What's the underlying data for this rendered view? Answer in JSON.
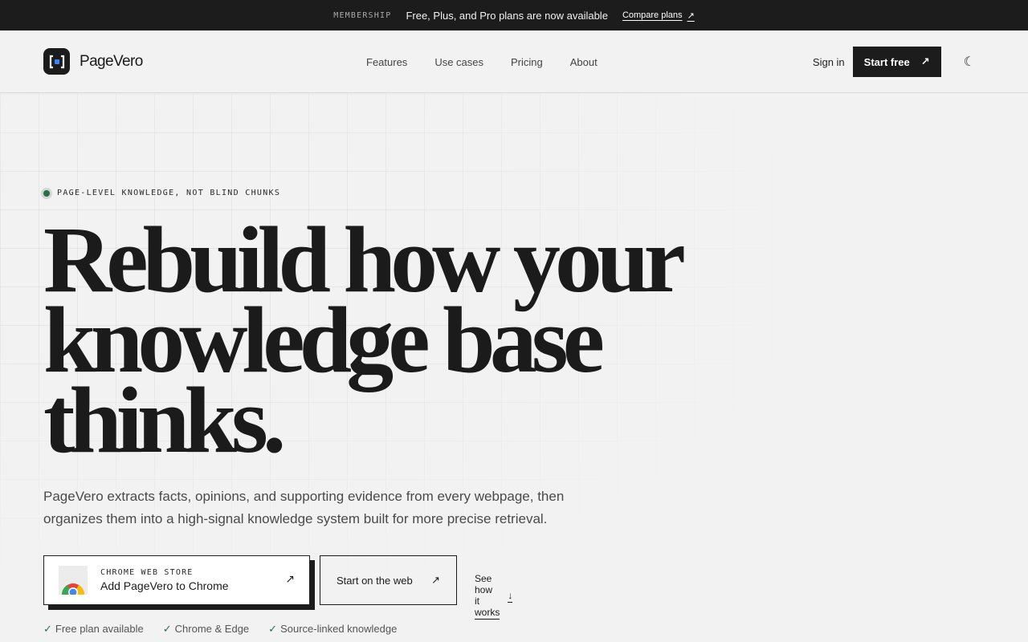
{
  "announcement": {
    "tag": "MEMBERSHIP",
    "message": "Free, Plus, and Pro plans are now available",
    "link_label": "Compare plans",
    "link_icon": "↗"
  },
  "nav": {
    "brand": "PageVero",
    "links": [
      "Features",
      "Use cases",
      "Pricing",
      "About"
    ],
    "sign_in": "Sign in",
    "start_free": "Start free",
    "start_free_icon": "↗",
    "theme_icon": "☾"
  },
  "hero": {
    "eyebrow": "PAGE-LEVEL KNOWLEDGE, NOT BLIND CHUNKS",
    "headline_lines": [
      "Rebuild how your",
      "knowledge base",
      "thinks."
    ],
    "subtitle": "PageVero extracts facts, opinions, and supporting evidence from every webpage, then organizes them into a high-signal knowledge system built for more precise retrieval.",
    "chrome_cta": {
      "tag": "CHROME WEB STORE",
      "label": "Add PageVero to Chrome",
      "icon": "↗"
    },
    "web_cta": {
      "label": "Start on the web",
      "icon": "↗"
    },
    "how_link": {
      "label": "See how it works",
      "icon": "↓"
    },
    "checks": [
      "Free plan available",
      "Chrome & Edge",
      "Source-linked knowledge"
    ],
    "check_icon": "✓"
  },
  "colors": {
    "dark": "#1c1c1c",
    "accent_green": "#2d6b4a",
    "background": "#f2f2f2"
  }
}
